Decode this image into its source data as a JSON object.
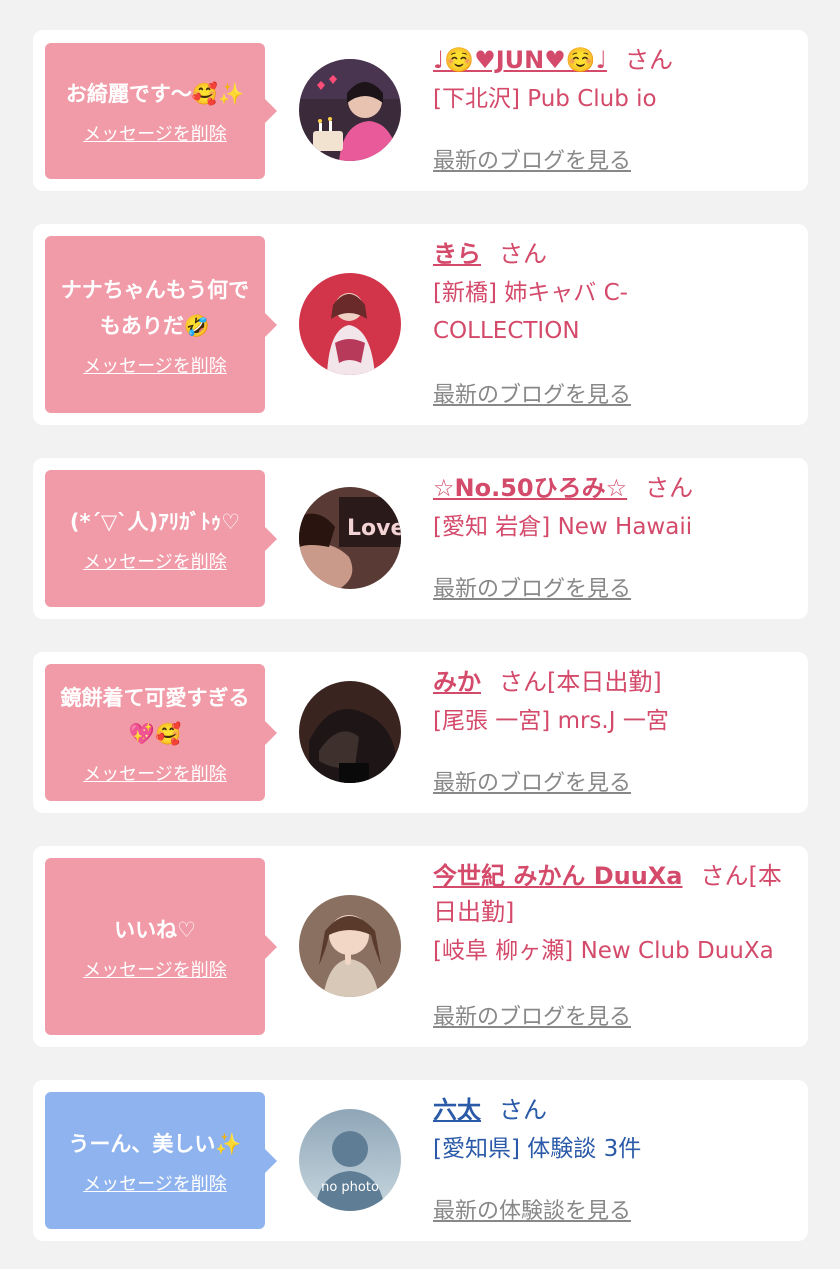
{
  "delete_label": "メッセージを削除",
  "colors": {
    "pink_bubble": "#f09ba7",
    "blue_bubble": "#8fb3ee",
    "pink_text": "#d44a6a",
    "blue_text": "#2a5aa8",
    "link_gray": "#888888"
  },
  "items": [
    {
      "message": "お綺麗です〜🥰✨",
      "name": "♩☺️♥JUN♥☺️♩",
      "san": "さん",
      "shop": "[下北沢] Pub Club io",
      "blog": "最新のブログを見る",
      "avatar_icon": "cast-photo-icon"
    },
    {
      "message": "ナナちゃんもう何でもありだ🤣",
      "name": "きら",
      "san": "さん",
      "shop": "[新橋] 姉キャバ C-COLLECTION",
      "blog": "最新のブログを見る",
      "avatar_icon": "cast-photo-icon"
    },
    {
      "message": "(*´▽`人)ｱﾘｶﾞﾄｩ♡",
      "name": "☆No.50ひろみ☆",
      "san": "さん",
      "shop": "[愛知 岩倉] New Hawaii",
      "blog": "最新のブログを見る",
      "avatar_icon": "cast-photo-icon",
      "avatar_text": "Love"
    },
    {
      "message": "鏡餅着て可愛すぎる💖🥰",
      "name": "みか",
      "san": "さん[本日出勤]",
      "shop": "[尾張 一宮] mrs.J 一宮",
      "blog": "最新のブログを見る",
      "avatar_icon": "cast-photo-icon"
    },
    {
      "message": "いいね♡",
      "name": "今世紀 みかん DuuXa",
      "san": "さん[本日出勤]",
      "shop": "[岐阜 柳ヶ瀬] New Club DuuXa",
      "blog": "最新のブログを見る",
      "avatar_icon": "cast-photo-icon"
    },
    {
      "message": "うーん、美しい✨",
      "name": "六太",
      "san": "さん",
      "shop": "[愛知県] 体験談 3件",
      "blog": "最新の体験談を見る",
      "avatar_icon": "no-photo-icon",
      "avatar_text": "no photo"
    }
  ]
}
